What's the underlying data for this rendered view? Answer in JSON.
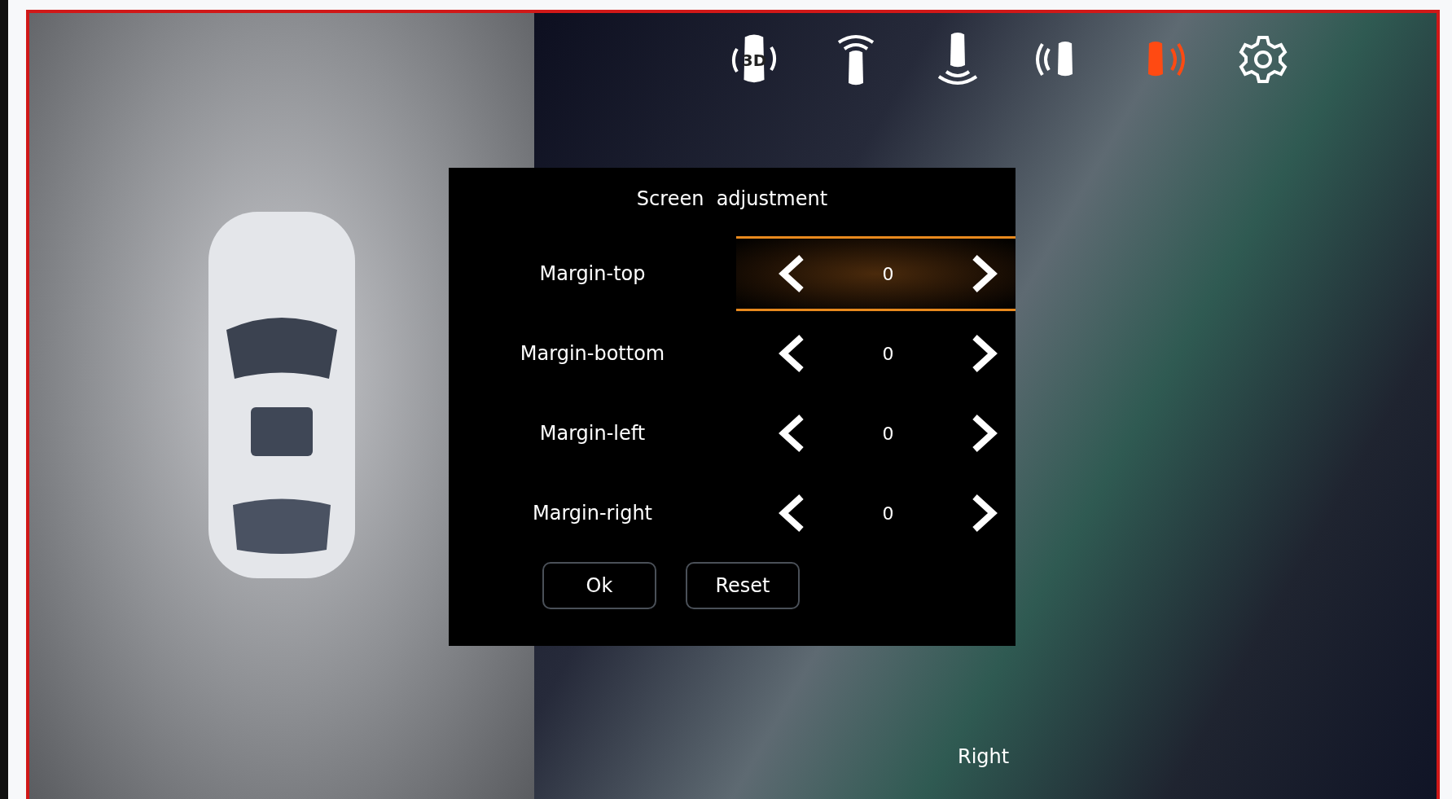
{
  "toolbar": [
    {
      "kind": "view-3d",
      "label": "3D",
      "selected": false
    },
    {
      "kind": "sensor-front",
      "selected": false
    },
    {
      "kind": "sensor-rear",
      "selected": false
    },
    {
      "kind": "sensor-left",
      "selected": false
    },
    {
      "kind": "sensor-right",
      "selected": true
    },
    {
      "kind": "settings",
      "selected": false
    }
  ],
  "dialog": {
    "title": "Screen  adjustment",
    "rows": [
      {
        "label": "Margin-top",
        "value": "0",
        "selected": true
      },
      {
        "label": "Margin-bottom",
        "value": "0",
        "selected": false
      },
      {
        "label": "Margin-left",
        "value": "0",
        "selected": false
      },
      {
        "label": "Margin-right",
        "value": "0",
        "selected": false
      }
    ],
    "buttons": [
      "Ok",
      "Reset"
    ]
  },
  "view_label": "Right"
}
